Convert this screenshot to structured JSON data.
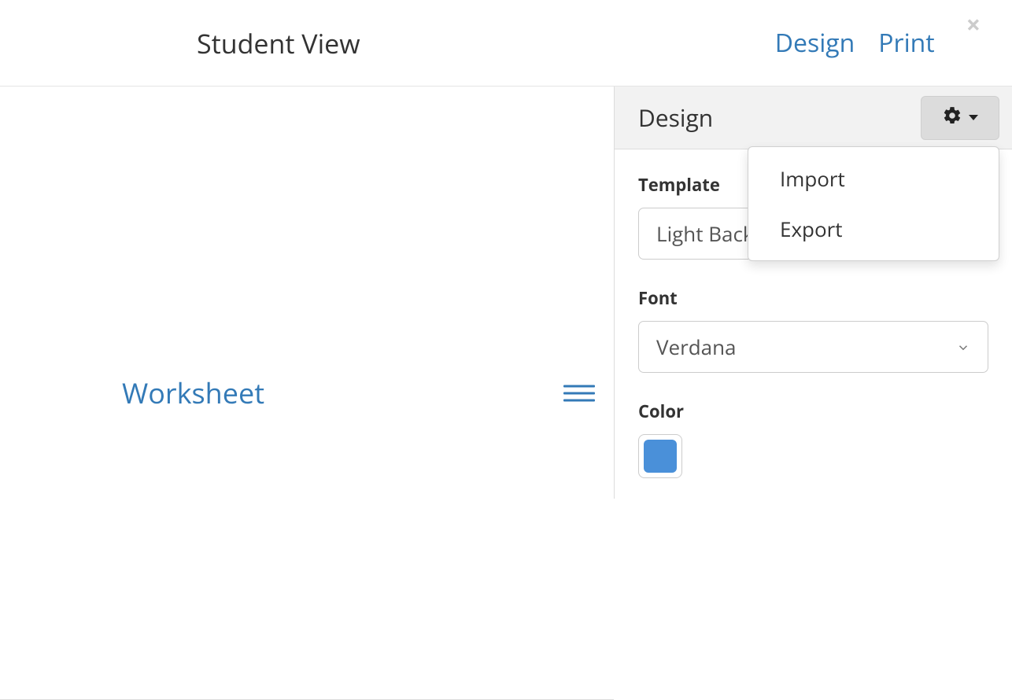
{
  "header": {
    "title": "Student View",
    "links": {
      "design": "Design",
      "print": "Print"
    }
  },
  "subheader": {
    "worksheet": "Worksheet"
  },
  "design_panel": {
    "title": "Design",
    "template": {
      "label": "Template",
      "value": "Light Background"
    },
    "font": {
      "label": "Font",
      "value": "Verdana"
    },
    "color": {
      "label": "Color",
      "value": "#4a90d9"
    },
    "menu": {
      "import": "Import",
      "export": "Export"
    }
  }
}
